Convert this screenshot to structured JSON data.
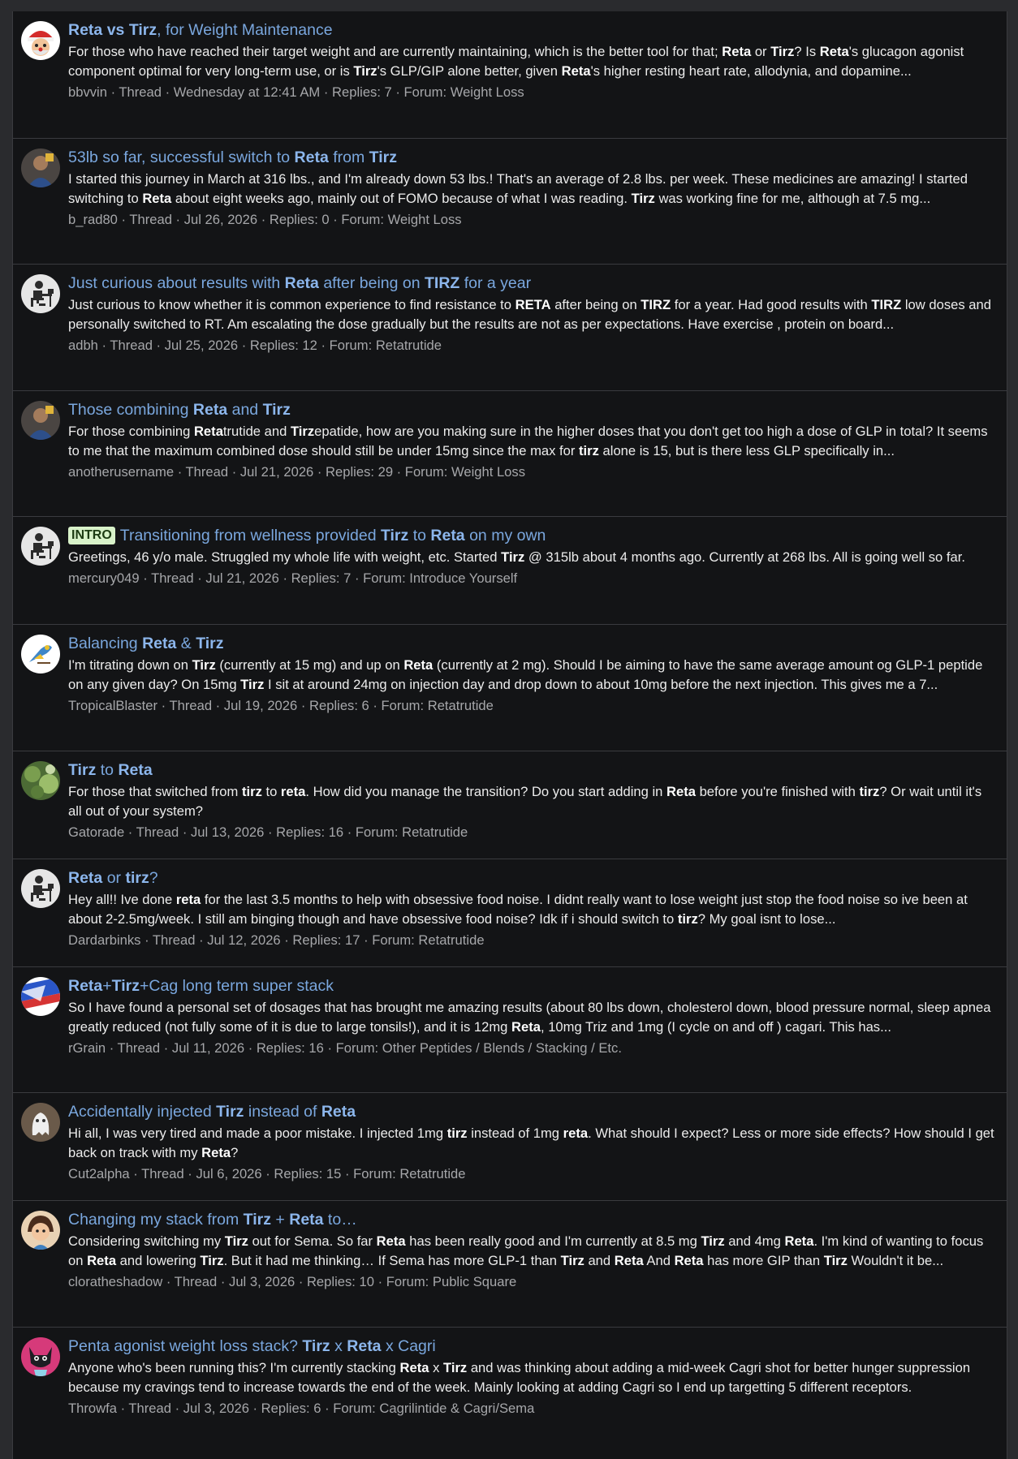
{
  "meta_labels": {
    "thread": "Thread",
    "replies_prefix": "Replies: ",
    "forum_prefix": "Forum: ",
    "sep": " · "
  },
  "results": [
    {
      "avatar_icon": "santa-avatar-icon",
      "title_parts": [
        {
          "t": "Reta",
          "b": true
        },
        {
          "t": " "
        },
        {
          "t": "vs",
          "b": true
        },
        {
          "t": " "
        },
        {
          "t": "Tirz",
          "b": true
        },
        {
          "t": ", for Weight Maintenance"
        }
      ],
      "snippet_parts": [
        {
          "t": "For those who have reached their target weight and are currently maintaining, which is the better tool for that; "
        },
        {
          "t": "Reta",
          "b": true
        },
        {
          "t": " or "
        },
        {
          "t": "Tirz",
          "b": true
        },
        {
          "t": "? Is "
        },
        {
          "t": "Reta",
          "b": true
        },
        {
          "t": "'s glucagon agonist component optimal for very long-term use, or is "
        },
        {
          "t": "Tirz",
          "b": true
        },
        {
          "t": "'s GLP/GIP alone better, given "
        },
        {
          "t": "Reta",
          "b": true
        },
        {
          "t": "'s higher resting heart rate, allodynia, and dopamine..."
        }
      ],
      "author": "bbvvin",
      "date": "Wednesday at 12:41 AM",
      "replies": "7",
      "forum": "Weight Loss"
    },
    {
      "avatar_icon": "photo-avatar-icon",
      "title_parts": [
        {
          "t": "53lb so far, successful switch to "
        },
        {
          "t": "Reta",
          "b": true
        },
        {
          "t": " from "
        },
        {
          "t": "Tirz",
          "b": true
        }
      ],
      "snippet_parts": [
        {
          "t": "I started this journey in March at 316 lbs., and I'm already down 53 lbs.! That's an average of 2.8 lbs. per week. These medicines are amazing! I started switching to "
        },
        {
          "t": "Reta",
          "b": true
        },
        {
          "t": " about eight weeks ago, mainly out of FOMO because of what I was reading. "
        },
        {
          "t": "Tirz",
          "b": true
        },
        {
          "t": " was working fine for me, although at 7.5 mg..."
        }
      ],
      "author": "b_rad80",
      "date": "Jul 26, 2026",
      "replies": "0",
      "forum": "Weight Loss"
    },
    {
      "avatar_icon": "default-user-avatar-icon",
      "title_parts": [
        {
          "t": "Just curious about results with "
        },
        {
          "t": "Reta",
          "b": true
        },
        {
          "t": " after being on "
        },
        {
          "t": "TIRZ",
          "b": true
        },
        {
          "t": " for a year"
        }
      ],
      "snippet_parts": [
        {
          "t": "Just curious to know whether it is common experience to find resistance to "
        },
        {
          "t": "RETA",
          "b": true
        },
        {
          "t": " after being on "
        },
        {
          "t": "TIRZ",
          "b": true
        },
        {
          "t": " for a year. Had good results with "
        },
        {
          "t": "TIRZ",
          "b": true
        },
        {
          "t": " low doses and personally switched to RT. Am escalating the dose gradually but the results are not as per expectations. Have exercise , protein on board..."
        }
      ],
      "author": "adbh",
      "date": "Jul 25, 2026",
      "replies": "12",
      "forum": "Retatrutide"
    },
    {
      "avatar_icon": "photo-avatar-icon",
      "title_parts": [
        {
          "t": "Those combining "
        },
        {
          "t": "Reta",
          "b": true
        },
        {
          "t": " and "
        },
        {
          "t": "Tirz",
          "b": true
        }
      ],
      "snippet_parts": [
        {
          "t": "For those combining "
        },
        {
          "t": "Reta",
          "b": true
        },
        {
          "t": "trutide and "
        },
        {
          "t": "Tirz",
          "b": true
        },
        {
          "t": "epatide, how are you making sure in the higher doses that you don't get too high a dose of GLP in total? It seems to me that the maximum combined dose should still be under 15mg since the max for "
        },
        {
          "t": "tirz",
          "b": true
        },
        {
          "t": " alone is 15, but is there less GLP specifically in..."
        }
      ],
      "author": "anotherusername",
      "date": "Jul 21, 2026",
      "replies": "29",
      "forum": "Weight Loss"
    },
    {
      "avatar_icon": "default-user-avatar-icon",
      "prefix_label": "INTRO",
      "title_parts": [
        {
          "t": "Transitioning from wellness provided "
        },
        {
          "t": "Tirz",
          "b": true
        },
        {
          "t": " to "
        },
        {
          "t": "Reta",
          "b": true
        },
        {
          "t": " on my own"
        }
      ],
      "snippet_parts": [
        {
          "t": "Greetings, 46 y/o male. Struggled my whole life with weight, etc. Started "
        },
        {
          "t": "Tirz",
          "b": true
        },
        {
          "t": " @ 315lb about 4 months ago. Currently at 268 lbs. All is going well so far."
        }
      ],
      "author": "mercury049",
      "date": "Jul 21, 2026",
      "replies": "7",
      "forum": "Introduce Yourself"
    },
    {
      "avatar_icon": "bird-avatar-icon",
      "title_parts": [
        {
          "t": "Balancing "
        },
        {
          "t": "Reta",
          "b": true
        },
        {
          "t": " & "
        },
        {
          "t": "Tirz",
          "b": true
        }
      ],
      "snippet_parts": [
        {
          "t": "I'm titrating down on "
        },
        {
          "t": "Tirz",
          "b": true
        },
        {
          "t": " (currently at 15 mg) and up on "
        },
        {
          "t": "Reta",
          "b": true
        },
        {
          "t": " (currently at 2 mg). Should I be aiming to have the same average amount og GLP-1 peptide on any given day? On 15mg "
        },
        {
          "t": "Tirz",
          "b": true
        },
        {
          "t": " I sit at around 24mg on injection day and drop down to about 10mg before the next injection. This gives me a 7..."
        }
      ],
      "author": "TropicalBlaster",
      "date": "Jul 19, 2026",
      "replies": "6",
      "forum": "Retatrutide"
    },
    {
      "avatar_icon": "plant-avatar-icon",
      "title_parts": [
        {
          "t": "Tirz",
          "b": true
        },
        {
          "t": " to "
        },
        {
          "t": "Reta",
          "b": true
        }
      ],
      "snippet_parts": [
        {
          "t": "For those that switched from "
        },
        {
          "t": "tirz",
          "b": true
        },
        {
          "t": " to "
        },
        {
          "t": "reta",
          "b": true
        },
        {
          "t": ". How did you manage the transition? Do you start adding in "
        },
        {
          "t": "Reta",
          "b": true
        },
        {
          "t": " before you're finished with "
        },
        {
          "t": "tirz",
          "b": true
        },
        {
          "t": "? Or wait until it's all out of your system?"
        }
      ],
      "author": "Gatorade",
      "date": "Jul 13, 2026",
      "replies": "16",
      "forum": "Retatrutide"
    },
    {
      "avatar_icon": "default-user-avatar-icon",
      "title_parts": [
        {
          "t": "Reta",
          "b": true
        },
        {
          "t": " or "
        },
        {
          "t": "tirz",
          "b": true
        },
        {
          "t": "?"
        }
      ],
      "snippet_parts": [
        {
          "t": "Hey all!! Ive done "
        },
        {
          "t": "reta",
          "b": true
        },
        {
          "t": " for the last 3.5 months to help with obsessive food noise. I didnt really want to lose weight just stop the food noise so ive been at about 2-2.5mg/week. I still am binging though and have obsessive food noise? Idk if i should switch to "
        },
        {
          "t": "tirz",
          "b": true
        },
        {
          "t": "? My goal isnt to lose..."
        }
      ],
      "author": "Dardarbinks",
      "date": "Jul 12, 2026",
      "replies": "17",
      "forum": "Retatrutide"
    },
    {
      "avatar_icon": "flag-avatar-icon",
      "title_parts": [
        {
          "t": "Reta",
          "b": true
        },
        {
          "t": "+"
        },
        {
          "t": "Tirz",
          "b": true
        },
        {
          "t": "+Cag long term super stack"
        }
      ],
      "snippet_parts": [
        {
          "t": "So I have found a personal set of dosages that has brought me amazing results (about 80 lbs down, cholesterol down, blood pressure normal, sleep apnea greatly reduced (not fully some of it is due to large tonsils!), and it is 12mg "
        },
        {
          "t": "Reta",
          "b": true
        },
        {
          "t": ", 10mg Triz and 1mg (I cycle on and off ) cagari. This has..."
        }
      ],
      "author": "rGrain",
      "date": "Jul 11, 2026",
      "replies": "16",
      "forum": "Other Peptides / Blends / Stacking / Etc."
    },
    {
      "avatar_icon": "ghost-avatar-icon",
      "title_parts": [
        {
          "t": "Accidentally injected "
        },
        {
          "t": "Tirz",
          "b": true
        },
        {
          "t": " instead of "
        },
        {
          "t": "Reta",
          "b": true
        }
      ],
      "snippet_parts": [
        {
          "t": "Hi all, I was very tired and made a poor mistake. I injected 1mg "
        },
        {
          "t": "tirz",
          "b": true
        },
        {
          "t": " instead of 1mg "
        },
        {
          "t": "reta",
          "b": true
        },
        {
          "t": ". What should I expect? Less or more side effects? How should I get back on track with my "
        },
        {
          "t": "Reta",
          "b": true
        },
        {
          "t": "?"
        }
      ],
      "author": "Cut2alpha",
      "date": "Jul 6, 2026",
      "replies": "15",
      "forum": "Retatrutide"
    },
    {
      "avatar_icon": "cartoon-avatar-icon",
      "title_parts": [
        {
          "t": "Changing my stack from "
        },
        {
          "t": "Tirz",
          "b": true
        },
        {
          "t": " + "
        },
        {
          "t": "Reta",
          "b": true
        },
        {
          "t": " to…"
        }
      ],
      "snippet_parts": [
        {
          "t": "Considering switching my "
        },
        {
          "t": "Tirz",
          "b": true
        },
        {
          "t": " out for Sema. So far "
        },
        {
          "t": "Reta",
          "b": true
        },
        {
          "t": " has been really good and I'm currently at 8.5 mg "
        },
        {
          "t": "Tirz",
          "b": true
        },
        {
          "t": " and 4mg "
        },
        {
          "t": "Reta",
          "b": true
        },
        {
          "t": ". I'm kind of wanting to focus on "
        },
        {
          "t": "Reta",
          "b": true
        },
        {
          "t": " and lowering "
        },
        {
          "t": "Tirz",
          "b": true
        },
        {
          "t": ". But it had me thinking… If Sema has more GLP-1 than "
        },
        {
          "t": "Tirz",
          "b": true
        },
        {
          "t": " and "
        },
        {
          "t": "Reta",
          "b": true
        },
        {
          "t": " And "
        },
        {
          "t": "Reta",
          "b": true
        },
        {
          "t": " has more GIP than "
        },
        {
          "t": "Tirz",
          "b": true
        },
        {
          "t": " Wouldn't it be..."
        }
      ],
      "author": "cloratheshadow",
      "date": "Jul 3, 2026",
      "replies": "10",
      "forum": "Public Square"
    },
    {
      "avatar_icon": "cat-avatar-icon",
      "title_parts": [
        {
          "t": "Penta agonist weight loss stack? "
        },
        {
          "t": "Tirz",
          "b": true
        },
        {
          "t": " x "
        },
        {
          "t": "Reta",
          "b": true
        },
        {
          "t": " x Cagri"
        }
      ],
      "snippet_parts": [
        {
          "t": "Anyone who's been running this? I'm currently stacking "
        },
        {
          "t": "Reta",
          "b": true
        },
        {
          "t": " x "
        },
        {
          "t": "Tirz",
          "b": true
        },
        {
          "t": " and was thinking about adding a mid-week Cagri shot for better hunger suppression because my cravings tend to increase towards the end of the week. Mainly looking at adding Cagri so I end up targetting 5 different receptors."
        }
      ],
      "author": "Throwfa",
      "date": "Jul 3, 2026",
      "replies": "6",
      "forum": "Cagrilintide & Cagri/Sema"
    }
  ]
}
